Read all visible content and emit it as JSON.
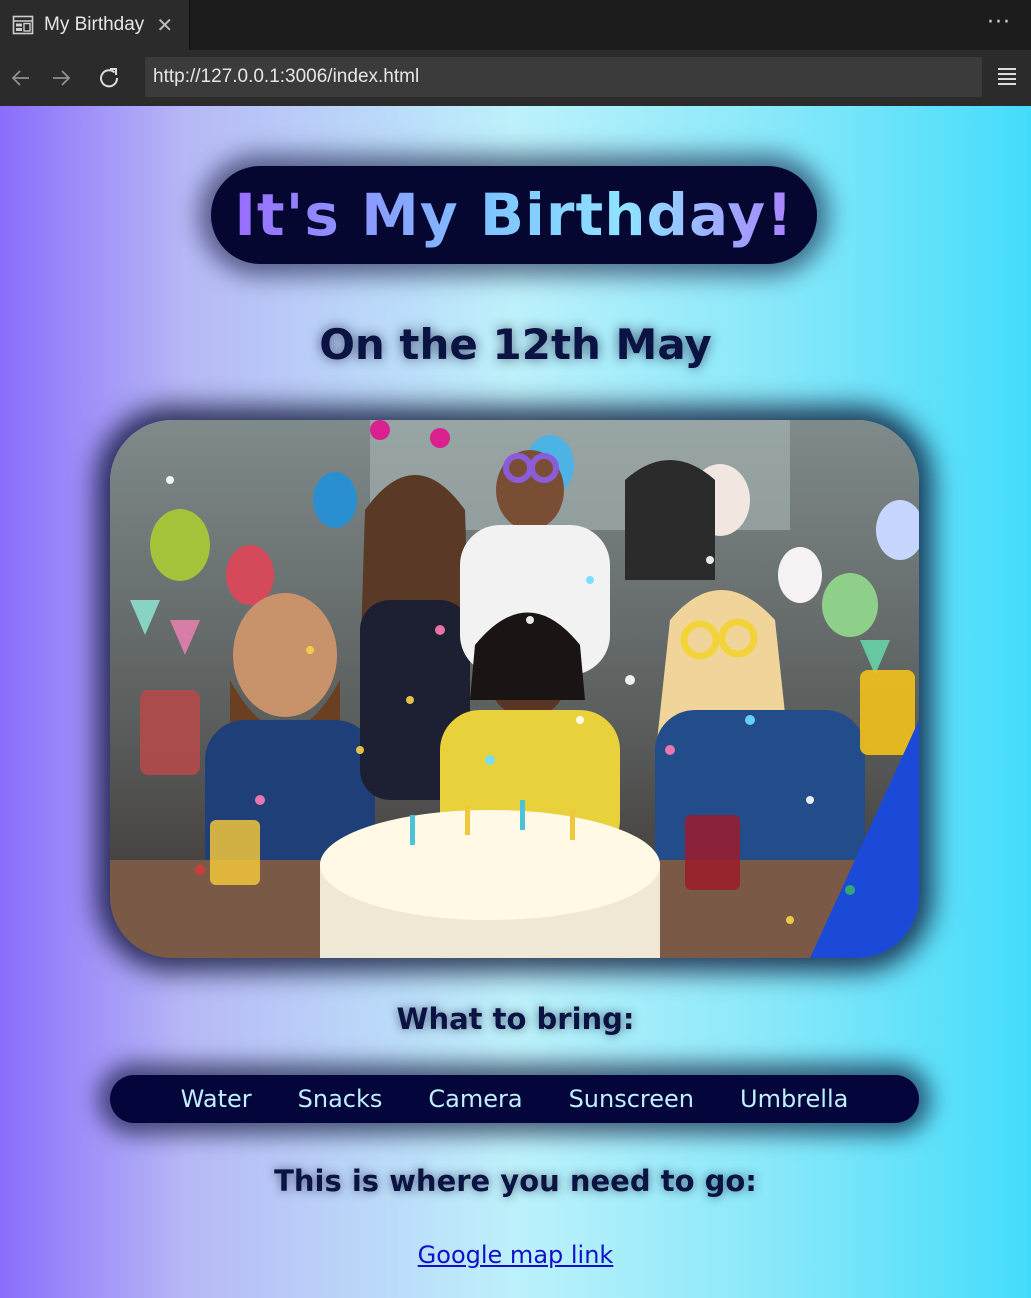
{
  "browser": {
    "tab_title": "My Birthday",
    "tab_close": "✕",
    "more": "···",
    "url": "http://127.0.0.1:3006/index.html",
    "icons": {
      "tab": "page-icon",
      "back": "arrow-left-icon",
      "forward": "arrow-right-icon",
      "reload": "reload-icon",
      "menu": "hamburger-icon"
    }
  },
  "page": {
    "title": "It's My Birthday!",
    "date_heading": "On the 12th May",
    "photo_subject": "party-photo",
    "bring_heading": "What to bring:",
    "bring_items": [
      "Water",
      "Snacks",
      "Camera",
      "Sunscreen",
      "Umbrella"
    ],
    "go_heading": "This is where you need to go:",
    "map_link": "Google map link"
  },
  "colors": {
    "title_pill": "#050730",
    "bring_bar": "#04053a",
    "heading_text": "#0a1342",
    "link": "#1410c8"
  }
}
